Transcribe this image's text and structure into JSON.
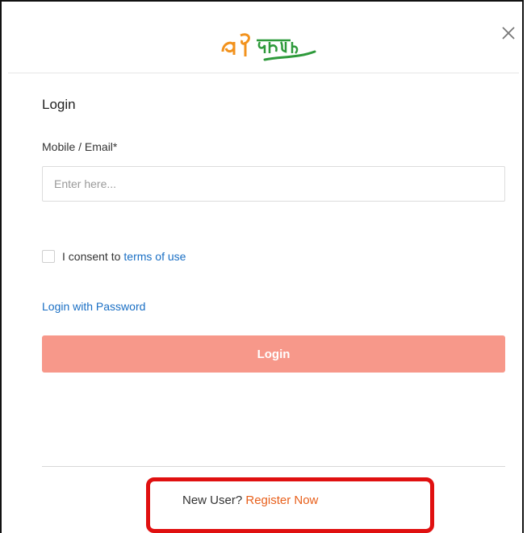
{
  "modal": {
    "title": "Login",
    "close_icon": "close-icon",
    "logo_icon": "brand-logo"
  },
  "form": {
    "field_label": "Mobile / Email*",
    "field_placeholder": "Enter here...",
    "field_value": "",
    "consent_text": "I consent to ",
    "consent_link": "terms of use",
    "consent_checked": false,
    "password_link": "Login with Password",
    "login_button": "Login"
  },
  "footer": {
    "new_user_text": "New User? ",
    "register_link": "Register Now"
  },
  "colors": {
    "accent_link": "#1a6fc4",
    "login_button_bg": "#f7988a",
    "register_link": "#e8601c",
    "highlight_border": "#e01010",
    "logo_orange": "#f2921d",
    "logo_green": "#2e9a3b"
  }
}
